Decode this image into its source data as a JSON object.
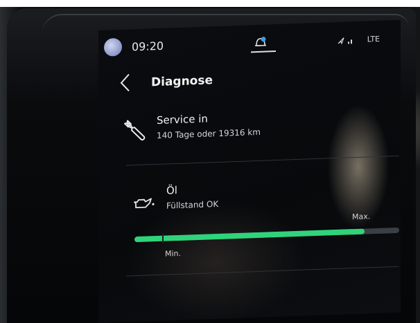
{
  "status": {
    "time": "09:20",
    "network": "LTE"
  },
  "header": {
    "title": "Diagnose"
  },
  "service": {
    "title": "Service in",
    "subtitle": "140 Tage oder 19316 km"
  },
  "oil": {
    "title": "Öl",
    "subtitle": "Füllstand OK",
    "max_label": "Max.",
    "min_label": "Min.",
    "level_fraction": 0.87
  },
  "colors": {
    "accent_green": "#2fd47a",
    "notification_blue": "#3aa0e0"
  }
}
